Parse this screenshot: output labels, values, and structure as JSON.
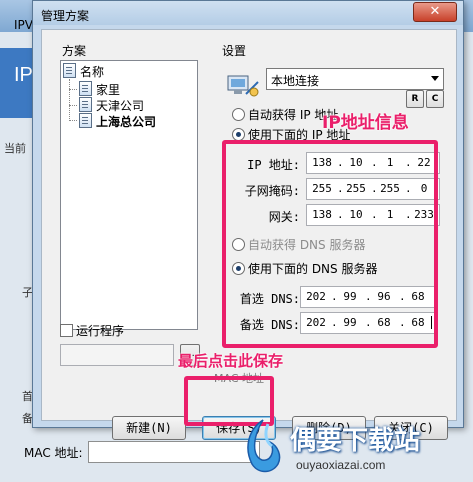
{
  "background_window": {
    "title": "IPV",
    "banner": "IP",
    "side_text_1": "当前",
    "side_text_2": "子",
    "side_text_3": "首",
    "side_text_4": "备",
    "mac_label": "MAC 地址:"
  },
  "dialog": {
    "title": "管理方案",
    "close_glyph": "✕"
  },
  "scheme": {
    "group_label": "方案",
    "root": "名称",
    "items": [
      "家里",
      "天津公司",
      "上海总公司"
    ]
  },
  "run_program": {
    "label": "运行程序",
    "checked": false,
    "browse_label": "..."
  },
  "settings": {
    "group_label": "设置",
    "connection": "本地连接",
    "r_button": "R",
    "c_button": "C",
    "auto_ip_label": "自动获得 IP 地址",
    "manual_ip_label": "使用下面的 IP 地址",
    "ip_label": "IP 地址:",
    "mask_label": "子网掩码:",
    "gateway_label": "网关:",
    "ip": [
      "138",
      "10",
      "1",
      "22"
    ],
    "mask": [
      "255",
      "255",
      "255",
      "0"
    ],
    "gateway": [
      "138",
      "10",
      "1",
      "233"
    ],
    "auto_dns_label": "自动获得 DNS 服务器",
    "manual_dns_label": "使用下面的 DNS 服务器",
    "dns1_label": "首选 DNS:",
    "dns2_label": "备选 DNS:",
    "dns1": [
      "202",
      "99",
      "96",
      "68"
    ],
    "dns2": [
      "202",
      "99",
      "68",
      "68"
    ],
    "mac_label": "MAC 地址"
  },
  "buttons": {
    "new": "新建(N)",
    "save": "保存(S)",
    "delete": "删除(D)",
    "close": "关闭(C)"
  },
  "annotations": {
    "ip_info": "IP地址信息",
    "save_hint": "最后点击此保存",
    "color": "#ea1f6a"
  },
  "watermark": {
    "main": "偶要下载站",
    "sub": "ouyaoxiazai.com"
  }
}
